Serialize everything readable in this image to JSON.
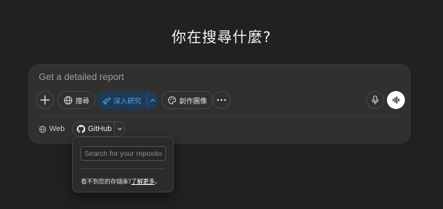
{
  "headline": "你在搜尋什麼?",
  "composer": {
    "placeholder": "Get a detailed report",
    "tools": {
      "add": {
        "icon": "plus-icon"
      },
      "search": {
        "label": "搜尋",
        "icon": "globe-icon"
      },
      "deep_research": {
        "label": "深入研究",
        "icon": "telescope-icon",
        "caret": "chevron-up-icon",
        "active_color": "#57a9f0"
      },
      "create_image": {
        "label": "創作圖像",
        "icon": "palette-icon"
      },
      "more": {
        "icon": "more-icon"
      },
      "mic": {
        "icon": "mic-icon"
      },
      "voice": {
        "icon": "voice-mode-icon"
      }
    },
    "sources": {
      "web": {
        "label": "Web",
        "icon": "globe-icon"
      },
      "github": {
        "label": "GitHub",
        "icon": "github-icon",
        "caret": "chevron-down-icon"
      }
    }
  },
  "github_popover": {
    "search_placeholder": "Search for your repositories",
    "note_text": "看不到您的存儲庫?",
    "note_link": "了解更多",
    "note_suffix": "。"
  }
}
